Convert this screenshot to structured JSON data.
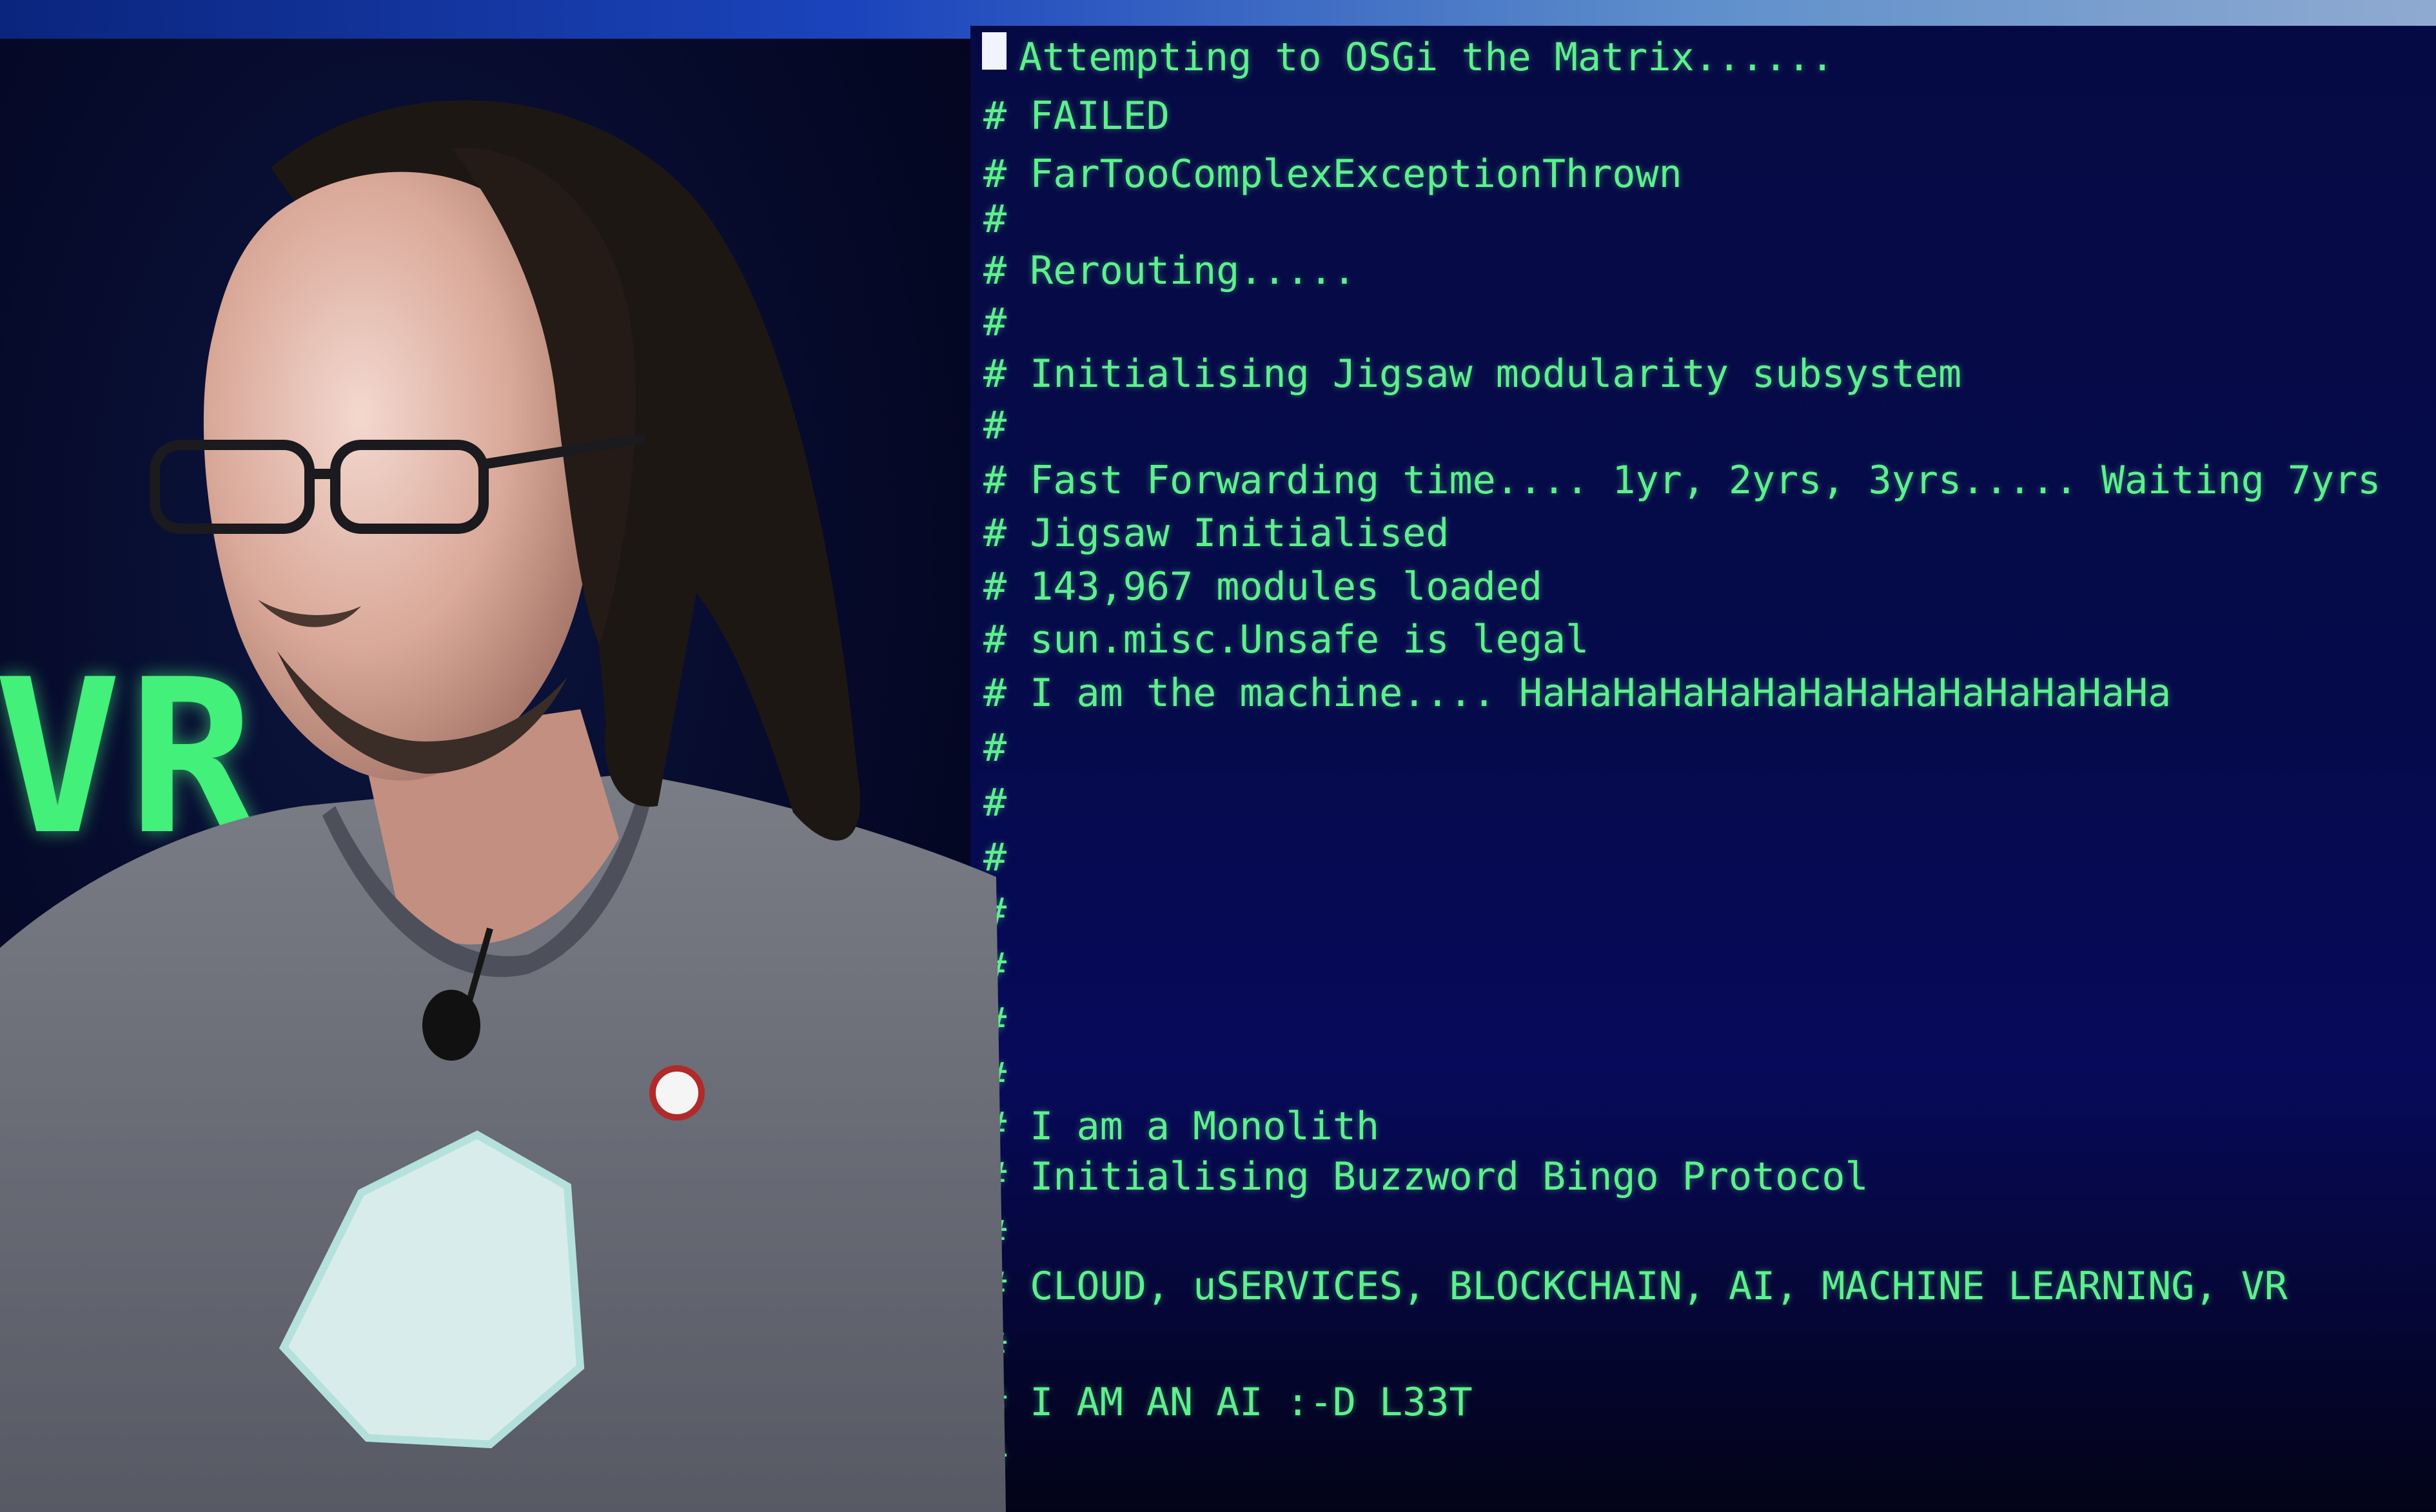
{
  "colors": {
    "terminal_background": "#060a44",
    "terminal_text": "#5ef08d",
    "stage_background": "#05051f",
    "shirt": "#6d6f7a",
    "hair": "#1a1512"
  },
  "background_sign": {
    "text": "VR"
  },
  "terminal": {
    "lines": [
      "Attempting to OSGi the Matrix......",
      "# FAILED",
      "# FarTooComplexExceptionThrown",
      "#",
      "# Rerouting.....",
      "#",
      "# Initialising Jigsaw modularity subsystem",
      "#",
      "# Fast Forwarding time.... 1yr, 2yrs, 3yrs..... Waiting 7yrs",
      "# Jigsaw Initialised",
      "# 143,967 modules loaded",
      "# sun.misc.Unsafe is legal",
      "# I am the machine.... HaHaHaHaHaHaHaHaHaHaHaHaHaHa",
      "#",
      "#",
      "#",
      "#",
      "#",
      "#",
      "#",
      "# I am a Monolith",
      "# Initialising Buzzword Bingo Protocol",
      "#",
      "# CLOUD, uSERVICES, BLOCKCHAIN, AI, MACHINE LEARNING, VR",
      "#",
      "# I AM AN AI :-D L33T",
      "#"
    ]
  }
}
